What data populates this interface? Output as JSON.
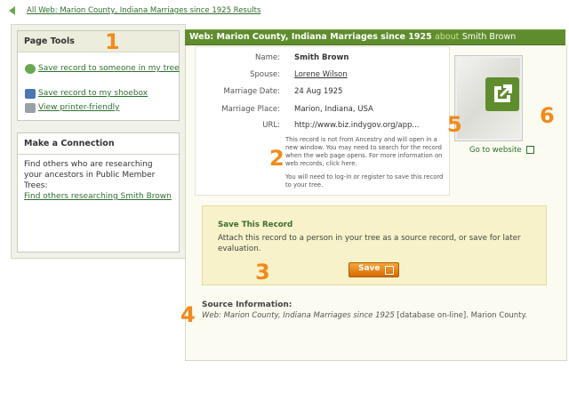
{
  "breadcrumb": {
    "label": "All Web: Marion County, Indiana Marriages since 1925 Results"
  },
  "page_tools": {
    "title": "Page Tools",
    "items": [
      {
        "label": "Save record to someone in my tree",
        "icon": "tree-save-icon"
      },
      {
        "label": "Save record to my shoebox",
        "icon": "shoebox-icon"
      },
      {
        "label": "View printer-friendly",
        "icon": "printer-icon"
      }
    ]
  },
  "make_connection": {
    "title": "Make a Connection",
    "body": "Find others who are researching your ancestors in Public Member Trees:",
    "link": "Find others researching Smith Brown"
  },
  "header": {
    "collection": "Web: Marion County, Indiana Marriages since 1925",
    "about": "about",
    "name": "Smith Brown"
  },
  "record": {
    "rows": [
      {
        "label": "Name:",
        "value": "Smith Brown"
      },
      {
        "label": "Spouse:",
        "value": "Lorene Wilson"
      },
      {
        "label": "Marriage Date:",
        "value": "24 Aug 1925"
      },
      {
        "label": "Marriage Place:",
        "value": "Marion, Indiana, USA"
      },
      {
        "label": "URL:",
        "value": "http://www.biz.indygov.org/app..."
      }
    ],
    "note1": "This record is not from Ancestry and will open in a new window. You may need to search for the record when the web page opens. For more information on web records, click here.",
    "note2": "You will need to log-in or register to save this record to your tree."
  },
  "thumbnail": {
    "go_label": "Go to website"
  },
  "save_record": {
    "title": "Save This Record",
    "desc": "Attach this record to a person in your tree as a source record, or save for later evaluation.",
    "button": "Save"
  },
  "source": {
    "label": "Source Information:",
    "text_italic": "Web: Marion County, Indiana Marriages since 1925",
    "text_rest": " [database on-line]. Marion County."
  },
  "callouts": {
    "n1": "1",
    "n2": "2",
    "n3": "3",
    "n4": "4",
    "n5": "5",
    "n6": "6"
  },
  "colors": {
    "brand_green": "#5f8d2e",
    "callout_orange": "#f28a1a",
    "save_orange": "#e57f12"
  }
}
